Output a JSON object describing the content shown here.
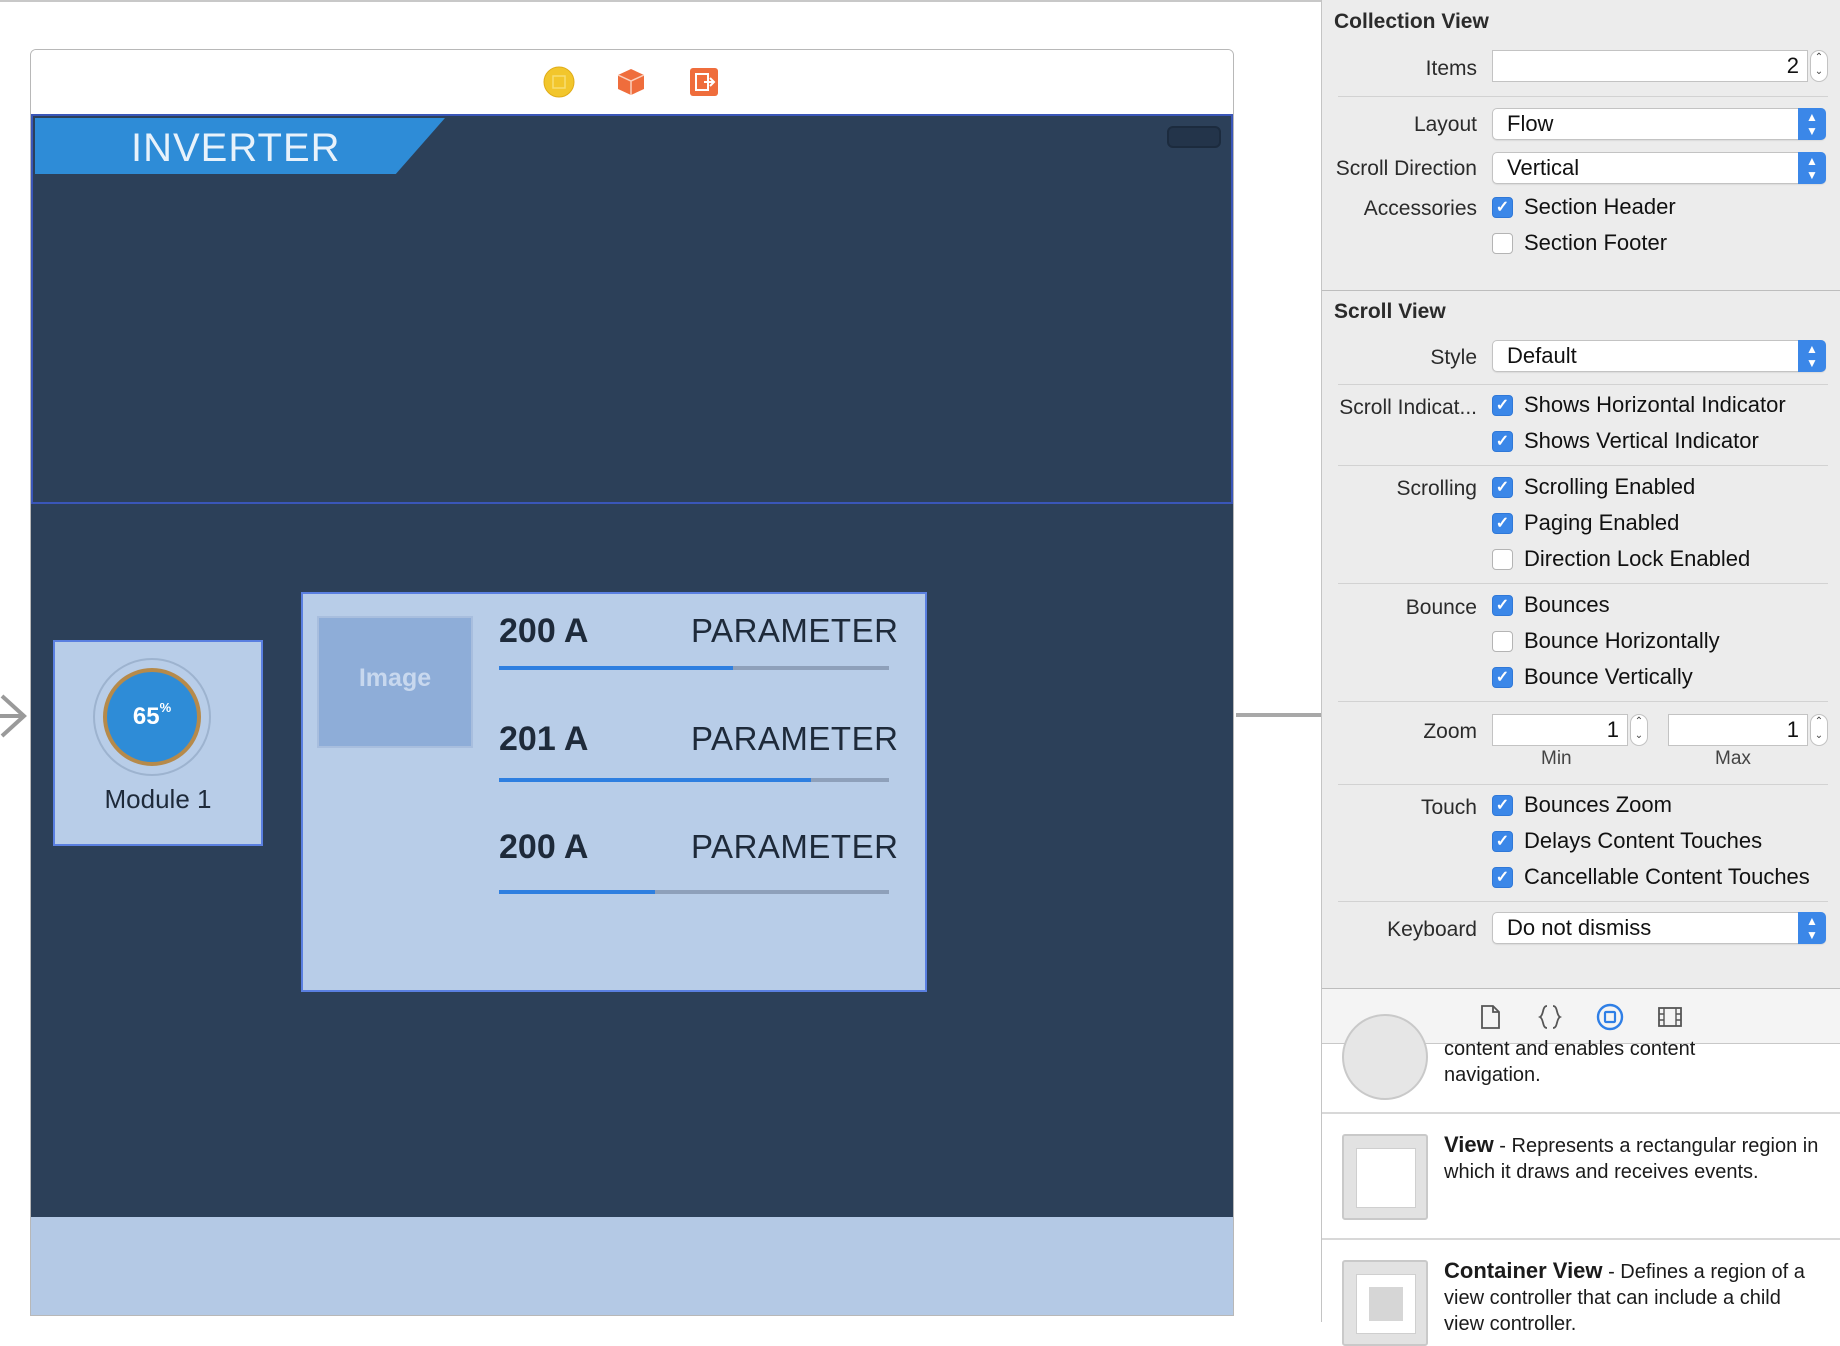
{
  "canvas": {
    "inverter_title": "INVERTER",
    "module": {
      "percent_value": "65",
      "percent_sign": "%",
      "label": "Module 1"
    },
    "image_placeholder": "Image",
    "parameters": [
      {
        "value": "200 A",
        "name": "PARAMETER",
        "fill": 0.6
      },
      {
        "value": "201 A",
        "name": "PARAMETER",
        "fill": 0.8
      },
      {
        "value": "200 A",
        "name": "PARAMETER",
        "fill": 0.4
      }
    ]
  },
  "inspector": {
    "collection_view": {
      "title": "Collection View",
      "items_label": "Items",
      "items_value": "2",
      "layout_label": "Layout",
      "layout_value": "Flow",
      "scroll_direction_label": "Scroll Direction",
      "scroll_direction_value": "Vertical",
      "accessories_label": "Accessories",
      "section_header": {
        "label": "Section Header",
        "checked": true
      },
      "section_footer": {
        "label": "Section Footer",
        "checked": false
      }
    },
    "scroll_view": {
      "title": "Scroll View",
      "style_label": "Style",
      "style_value": "Default",
      "scroll_indicators_label": "Scroll Indicat...",
      "shows_horizontal": {
        "label": "Shows Horizontal Indicator",
        "checked": true
      },
      "shows_vertical": {
        "label": "Shows Vertical Indicator",
        "checked": true
      },
      "scrolling_label": "Scrolling",
      "scrolling_enabled": {
        "label": "Scrolling Enabled",
        "checked": true
      },
      "paging_enabled": {
        "label": "Paging Enabled",
        "checked": true
      },
      "direction_lock": {
        "label": "Direction Lock Enabled",
        "checked": false
      },
      "bounce_label": "Bounce",
      "bounces": {
        "label": "Bounces",
        "checked": true
      },
      "bounce_horizontally": {
        "label": "Bounce Horizontally",
        "checked": false
      },
      "bounce_vertically": {
        "label": "Bounce Vertically",
        "checked": true
      },
      "zoom_label": "Zoom",
      "zoom_min_value": "1",
      "zoom_max_value": "1",
      "zoom_min_label": "Min",
      "zoom_max_label": "Max",
      "touch_label": "Touch",
      "bounces_zoom": {
        "label": "Bounces Zoom",
        "checked": true
      },
      "delays_content_touches": {
        "label": "Delays Content Touches",
        "checked": true
      },
      "cancellable_content_touches": {
        "label": "Cancellable Content Touches",
        "checked": true
      },
      "keyboard_label": "Keyboard",
      "keyboard_value": "Do not dismiss"
    }
  },
  "library": {
    "tabs": [
      "file-icon",
      "braces-icon",
      "object-icon",
      "media-icon"
    ],
    "items": [
      {
        "desc_line1": "content and enables content",
        "desc_line2": "navigation."
      },
      {
        "name": "View",
        "desc": " - Represents a rectangular region in which it draws and receives events."
      },
      {
        "name": "Container View",
        "desc": " - Defines a region of a view controller that can include a child view controller."
      }
    ]
  },
  "colors": {
    "canvas_background": "#2c4059",
    "accent": "#2e8cd7",
    "cell_background": "#b8cde8",
    "checkbox_blue": "#3b87e8"
  }
}
